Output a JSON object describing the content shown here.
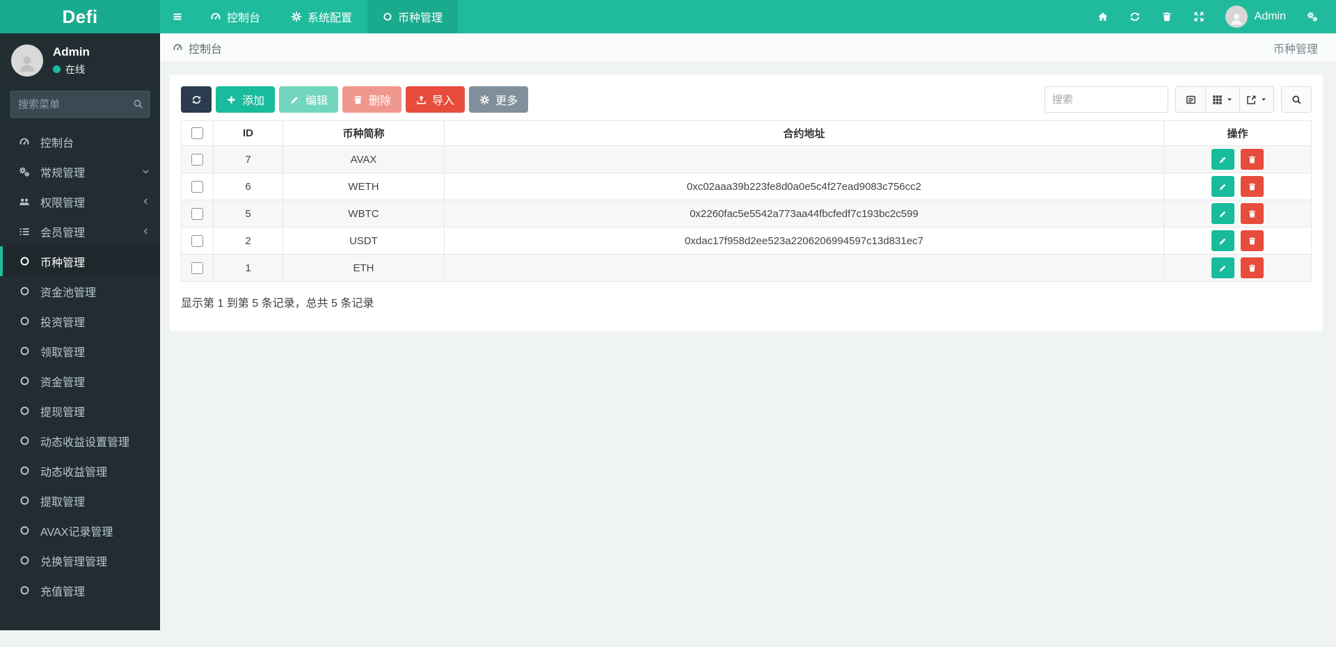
{
  "topbar": {
    "logo": "Defi",
    "tabs": [
      {
        "label": "控制台"
      },
      {
        "label": "系统配置"
      },
      {
        "label": "币种管理"
      }
    ],
    "username": "Admin"
  },
  "sidebar": {
    "user_name": "Admin",
    "user_status": "在线",
    "search_placeholder": "搜索菜单",
    "items": [
      {
        "label": "控制台",
        "icon": "gauge-icon"
      },
      {
        "label": "常规管理",
        "icon": "cogs-icon",
        "chevron": "down"
      },
      {
        "label": "权限管理",
        "icon": "users-icon",
        "chevron": "left"
      },
      {
        "label": "会员管理",
        "icon": "list-icon",
        "chevron": "left"
      },
      {
        "label": "币种管理",
        "icon": "circle-icon",
        "active": true
      },
      {
        "label": "资金池管理",
        "icon": "circle-icon"
      },
      {
        "label": "投资管理",
        "icon": "circle-icon"
      },
      {
        "label": "领取管理",
        "icon": "circle-icon"
      },
      {
        "label": "资金管理",
        "icon": "circle-icon"
      },
      {
        "label": "提现管理",
        "icon": "circle-icon"
      },
      {
        "label": "动态收益设置管理",
        "icon": "circle-icon"
      },
      {
        "label": "动态收益管理",
        "icon": "circle-icon"
      },
      {
        "label": "提取管理",
        "icon": "circle-icon"
      },
      {
        "label": "AVAX记录管理",
        "icon": "circle-icon"
      },
      {
        "label": "兑换管理管理",
        "icon": "circle-icon"
      },
      {
        "label": "充值管理",
        "icon": "circle-icon"
      }
    ]
  },
  "breadcrumb": {
    "left": "控制台",
    "right": "币种管理"
  },
  "toolbar": {
    "add_label": "添加",
    "edit_label": "编辑",
    "delete_label": "删除",
    "import_label": "导入",
    "more_label": "更多",
    "search_placeholder": "搜索"
  },
  "table": {
    "headers": {
      "id": "ID",
      "symbol": "币种简称",
      "contract": "合约地址",
      "actions": "操作"
    },
    "rows": [
      {
        "id": "7",
        "symbol": "AVAX",
        "contract": ""
      },
      {
        "id": "6",
        "symbol": "WETH",
        "contract": "0xc02aaa39b223fe8d0a0e5c4f27ead9083c756cc2"
      },
      {
        "id": "5",
        "symbol": "WBTC",
        "contract": "0x2260fac5e5542a773aa44fbcfedf7c193bc2c599"
      },
      {
        "id": "2",
        "symbol": "USDT",
        "contract": "0xdac17f958d2ee523a2206206994597c13d831ec7"
      },
      {
        "id": "1",
        "symbol": "ETH",
        "contract": ""
      }
    ],
    "summary": "显示第 1 到第 5 条记录，总共 5 条记录"
  },
  "colors": {
    "topbar": "#20bb9c",
    "topbar_dark": "#1aab8e",
    "sidebar_bg": "#222d32",
    "accent": "#1ebc9e",
    "success": "#18bc9c",
    "danger": "#e74c3c",
    "dark": "#2b3c4e"
  }
}
